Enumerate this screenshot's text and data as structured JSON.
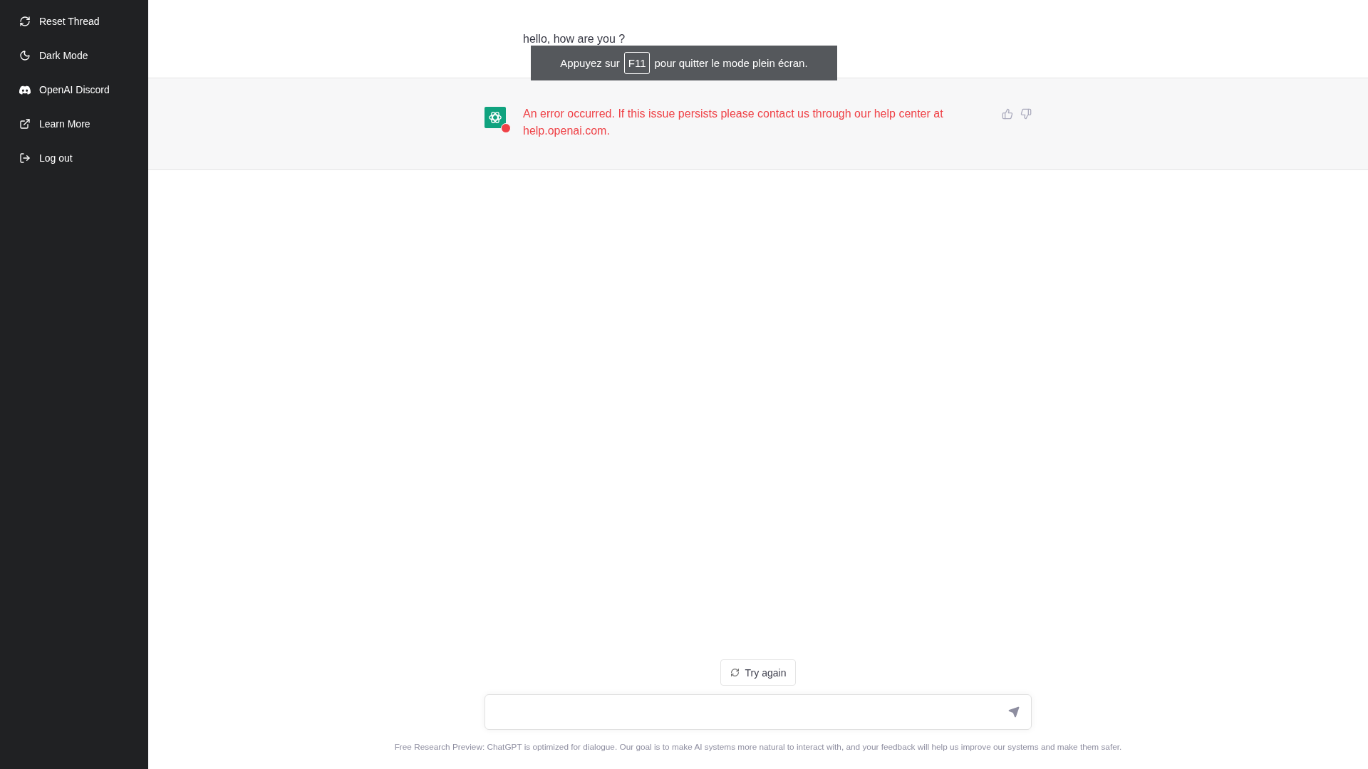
{
  "sidebar": {
    "items": [
      {
        "kind": "reset",
        "label": "Reset Thread"
      },
      {
        "kind": "moon",
        "label": "Dark Mode"
      },
      {
        "kind": "discord",
        "label": "OpenAI Discord"
      },
      {
        "kind": "external",
        "label": "Learn More"
      },
      {
        "kind": "logout",
        "label": "Log out"
      }
    ]
  },
  "user_message": "hello, how are you ?",
  "fullscreen_notice": {
    "before": "Appuyez sur",
    "key": "F11",
    "after": "pour quitter le mode plein écran."
  },
  "error_message": "An error occurred. If this issue persists please contact us through our help center at help.openai.com.",
  "try_again": "Try again",
  "footer": "Free Research Preview: ChatGPT is optimized for dialogue. Our goal is to make AI systems more natural to interact with, and your feedback will help us improve our systems and make them safer."
}
